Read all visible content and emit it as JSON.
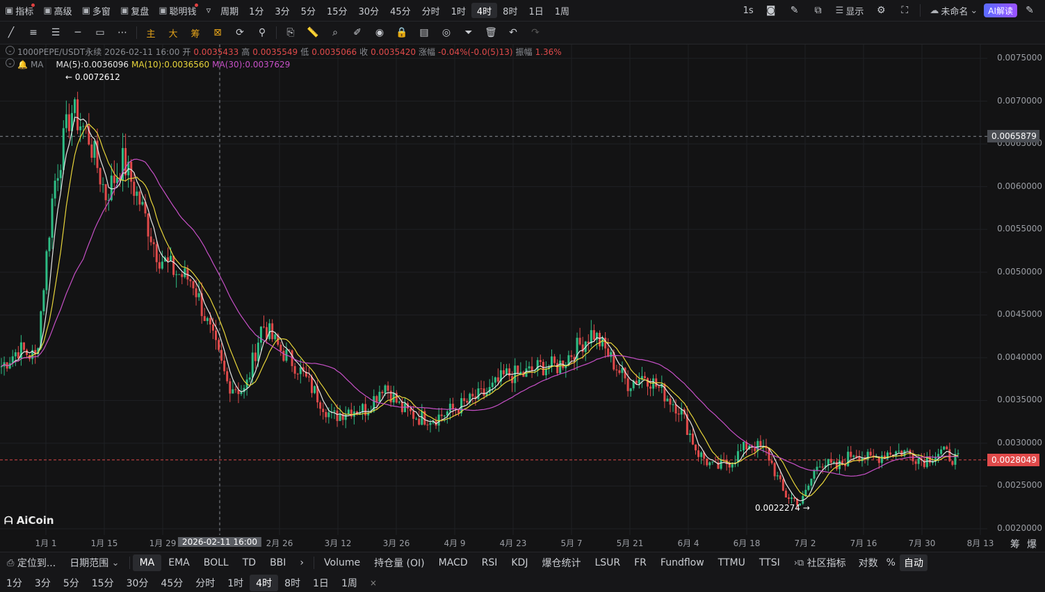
{
  "topbar": {
    "items": [
      {
        "icon": "indicator-icon",
        "label": "指标",
        "dot": true
      },
      {
        "icon": "advanced-icon",
        "label": "高级",
        "dot": false
      },
      {
        "icon": "multi-window-icon",
        "label": "多窗",
        "dot": false
      },
      {
        "icon": "replay-icon",
        "label": "复盘",
        "dot": false
      },
      {
        "icon": "smart-money-icon",
        "label": "聪明钱",
        "dot": true
      }
    ],
    "more_label": "▿",
    "period_label": "周期",
    "periods": [
      "1分",
      "3分",
      "5分",
      "15分",
      "30分",
      "45分",
      "分时",
      "1时",
      "4时",
      "8时",
      "1日",
      "1周"
    ],
    "active_period": "4时",
    "right": {
      "interval": "1s",
      "display_label": "显示",
      "layout_name": "未命名",
      "ai_label": "AI解读"
    }
  },
  "toolbar": {
    "cn_tools": [
      "主",
      "大",
      "筹"
    ]
  },
  "info": {
    "symbol": "1000PEPE/USDT永续",
    "datetime": "2026-02-11 16:00",
    "open_label": "开",
    "open": "0.0035433",
    "high_label": "高",
    "high": "0.0035549",
    "low_label": "低",
    "low": "0.0035066",
    "close_label": "收",
    "close": "0.0035420",
    "change_label": "涨幅",
    "change": "-0.04%(-0.0(5)13)",
    "amp_label": "振幅",
    "amp": "1.36%",
    "ma_name": "MA",
    "ma5": "MA(5):0.0036096",
    "ma10": "MA(10):0.0036560",
    "ma30": "MA(30):0.0037629"
  },
  "price_axis": {
    "labels": [
      "0.0075000",
      "0.0070000",
      "0.0065000",
      "0.0060000",
      "0.0055000",
      "0.0050000",
      "0.0045000",
      "0.0040000",
      "0.0035000",
      "0.0030000",
      "0.0025000",
      "0.0020000"
    ],
    "crosshair_price": "0.0065879",
    "last_price": "0.0028049"
  },
  "time_axis": {
    "labels": [
      "1月 1",
      "1月 15",
      "1月 29",
      "2026-02-11 16:00",
      "2月 26",
      "3月 12",
      "3月 26",
      "4月 9",
      "4月 23",
      "5月 7",
      "5月 21",
      "6月 4",
      "6月 18",
      "7月 2",
      "7月 16",
      "7月 30",
      "8月 13"
    ],
    "highlight_index": 3,
    "right_labels": [
      "筹",
      "爆"
    ]
  },
  "extremes": {
    "high": "0.0072612",
    "low": "0.0022274"
  },
  "logo": "AiCoin",
  "indicators_bar": {
    "left": [
      "定位到...",
      "日期范围"
    ],
    "main": [
      "MA",
      "EMA",
      "BOLL",
      "TD",
      "BBI"
    ],
    "active_main": "MA",
    "sub": [
      "Volume",
      "持仓量 (OI)",
      "MACD",
      "RSI",
      "KDJ",
      "爆仓统计",
      "LSUR",
      "FR",
      "Fundflow",
      "TTMU",
      "TTSI"
    ],
    "community": "社区指标",
    "right": [
      "对数",
      "%",
      "自动"
    ]
  },
  "period_bar2": {
    "items": [
      "1分",
      "3分",
      "5分",
      "15分",
      "30分",
      "45分",
      "分时",
      "1时",
      "4时",
      "8时",
      "1日",
      "1周"
    ],
    "active": "4时",
    "close": "×"
  },
  "colors": {
    "up": "#2ebd85",
    "down": "#e04a4a",
    "ma5": "#e6e6e6",
    "ma10": "#e8d53a",
    "ma30": "#c750c7"
  },
  "chart_data": {
    "type": "candlestick",
    "title": "",
    "ylim": [
      0.002,
      0.0075
    ],
    "x_dates": [
      "12-27",
      "1-01",
      "1-05",
      "1-07",
      "1-09",
      "1-11",
      "1-13",
      "1-15",
      "1-17",
      "1-20",
      "1-24",
      "1-29",
      "2-02",
      "2-06",
      "2-11",
      "2-15",
      "2-18",
      "2-22",
      "2-26",
      "3-02",
      "3-06",
      "3-10",
      "3-12",
      "3-16",
      "3-20",
      "3-26",
      "4-01",
      "4-06",
      "4-09",
      "4-15",
      "4-20",
      "4-23",
      "4-28",
      "5-03",
      "5-07",
      "5-10",
      "5-14",
      "5-18",
      "5-21",
      "5-25",
      "5-30",
      "6-04",
      "6-07",
      "6-12",
      "6-18",
      "6-22",
      "6-26",
      "7-02",
      "7-06",
      "7-10",
      "7-16",
      "7-20",
      "7-25",
      "7-30",
      "8-03",
      "8-06"
    ],
    "close": [
      0.0039,
      0.0041,
      0.004,
      0.006,
      0.0069,
      0.0066,
      0.0059,
      0.0063,
      0.0058,
      0.0052,
      0.005,
      0.0049,
      0.0043,
      0.0037,
      0.0036,
      0.0044,
      0.0041,
      0.0039,
      0.0036,
      0.0033,
      0.0034,
      0.0034,
      0.0037,
      0.0034,
      0.0033,
      0.0033,
      0.0034,
      0.0035,
      0.0036,
      0.0038,
      0.0038,
      0.0039,
      0.0039,
      0.0041,
      0.0043,
      0.004,
      0.0037,
      0.0038,
      0.0036,
      0.0034,
      0.0029,
      0.0027,
      0.0028,
      0.003,
      0.0029,
      0.0024,
      0.0023,
      0.0028,
      0.0027,
      0.0029,
      0.0028,
      0.0029,
      0.0029,
      0.0028,
      0.0029,
      0.0028
    ],
    "series": [
      {
        "name": "MA(5)",
        "last": 0.0036096
      },
      {
        "name": "MA(10)",
        "last": 0.003656
      },
      {
        "name": "MA(30)",
        "last": 0.0037629
      }
    ],
    "annotations": [
      {
        "text": "0.0072612",
        "x": "1-09",
        "y": 0.0072612
      },
      {
        "text": "0.0022274",
        "x": "6-30",
        "y": 0.0022274
      }
    ]
  }
}
